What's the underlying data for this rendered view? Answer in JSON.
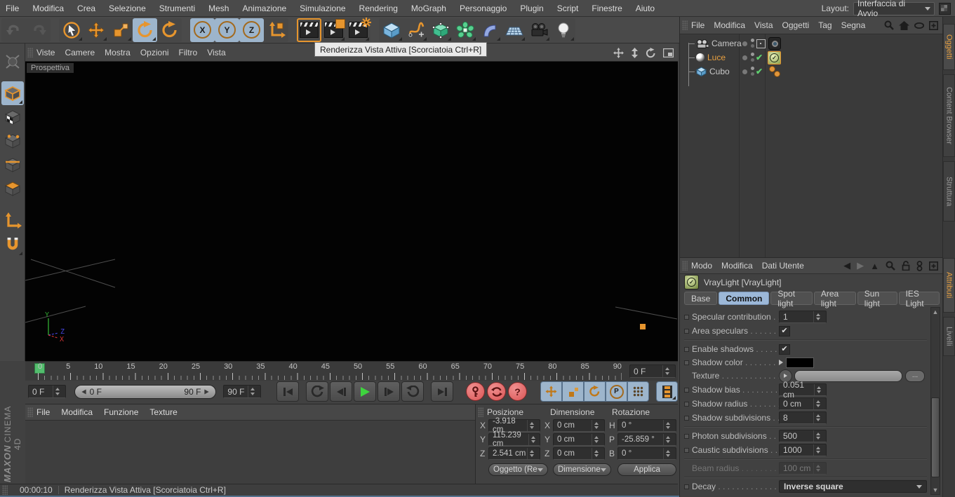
{
  "window": {
    "layout_label": "Layout:",
    "layout_value": "Interfaccia di Avvio"
  },
  "menubar": {
    "items": [
      "File",
      "Modifica",
      "Crea",
      "Selezione",
      "Strumenti",
      "Mesh",
      "Animazione",
      "Simulazione",
      "Rendering",
      "MoGraph",
      "Personaggio",
      "Plugin",
      "Script",
      "Finestre",
      "Aiuto"
    ]
  },
  "toolbar": {
    "axis_x": "X",
    "axis_y": "Y",
    "axis_z": "Z",
    "tooltip": "Renderizza Vista Attiva [Scorciatoia Ctrl+R]"
  },
  "viewport": {
    "menu": [
      "Viste",
      "Camere",
      "Mostra",
      "Opzioni",
      "Filtro",
      "Vista"
    ],
    "view_label": "Prospettiva",
    "axes": {
      "x": "X",
      "y": "Y",
      "z": "Z"
    }
  },
  "timeline": {
    "ticks": [
      "0",
      "5",
      "10",
      "15",
      "20",
      "25",
      "30",
      "35",
      "40",
      "45",
      "50",
      "55",
      "60",
      "65",
      "70",
      "75",
      "80",
      "85",
      "90"
    ],
    "current": "0 F",
    "start": "0 F",
    "end": "90 F",
    "slider_start": "0 F",
    "slider_end": "90 F"
  },
  "material_manager": {
    "menu": [
      "File",
      "Modifica",
      "Funzione",
      "Texture"
    ]
  },
  "coordinates": {
    "position_title": "Posizione",
    "size_title": "Dimensione",
    "rotation_title": "Rotazione",
    "pos": {
      "x_label": "X",
      "x": "-3.918 cm",
      "y_label": "Y",
      "y": "115.239 cm",
      "z_label": "Z",
      "z": "2.541 cm"
    },
    "size": {
      "x_label": "X",
      "x": "0 cm",
      "y_label": "Y",
      "y": "0 cm",
      "z_label": "Z",
      "z": "0 cm"
    },
    "rot": {
      "h_label": "H",
      "h": "0 °",
      "p_label": "P",
      "p": "-25.859 °",
      "b_label": "B",
      "b": "0 °"
    },
    "object_dropdown": "Oggetto (Re",
    "size_dropdown": "Dimensione",
    "apply_button": "Applica"
  },
  "statusbar": {
    "time": "00:00:10",
    "message": "Renderizza Vista Attiva [Scorciatoia Ctrl+R]"
  },
  "object_manager": {
    "menu": [
      "File",
      "Modifica",
      "Vista",
      "Oggetti",
      "Tag",
      "Segna"
    ],
    "objects": [
      {
        "name": "Camera"
      },
      {
        "name": "Luce"
      },
      {
        "name": "Cubo"
      }
    ]
  },
  "attribute_manager": {
    "menu": [
      "Modo",
      "Modifica",
      "Dati Utente"
    ],
    "title": "VrayLight [VrayLight]",
    "tabs": [
      "Base",
      "Common",
      "Spot light",
      "Area light",
      "Sun light",
      "IES Light"
    ],
    "active_tab": "Common",
    "props": {
      "specular_contribution": {
        "label": "Specular contribution",
        "value": "1"
      },
      "area_speculars": {
        "label": "Area speculars",
        "checked": true
      },
      "enable_shadows": {
        "label": "Enable shadows",
        "checked": true
      },
      "shadow_color": {
        "label": "Shadow color",
        "color": "#000000"
      },
      "texture": {
        "label": "Texture"
      },
      "shadow_bias": {
        "label": "Shadow bias",
        "value": "0.051 cm"
      },
      "shadow_radius": {
        "label": "Shadow radius",
        "value": "0 cm"
      },
      "shadow_subdivisions": {
        "label": "Shadow subdivisions",
        "value": "8"
      },
      "photon_subdivisions": {
        "label": "Photon subdivisions",
        "value": "500"
      },
      "caustic_subdivisions": {
        "label": "Caustic subdivisions",
        "value": "1000"
      },
      "beam_radius": {
        "label": "Beam radius",
        "value": "100 cm",
        "disabled": true
      },
      "decay": {
        "label": "Decay",
        "value": "Inverse square"
      }
    }
  },
  "side_tabs": {
    "objects": "Oggetti",
    "content_browser": "Content Browser",
    "structure": "Struttura",
    "attributes": "Attributi",
    "layers": "Livelli"
  },
  "logo": {
    "brand": "MAXON",
    "product": "CINEMA 4D"
  },
  "icons": {
    "check": "✔",
    "question": "?",
    "record_param": "P",
    "back": "◀",
    "forward": "▶",
    "cursor": "▲",
    "up": "▲",
    "down": "▼"
  },
  "colors": {
    "accent_orange": "#e6952e",
    "highlight_blue": "#9db5cc",
    "selection_green": "#53bd6d",
    "active_tab_text": "#e8a040",
    "viewport_bg": "#030303"
  }
}
